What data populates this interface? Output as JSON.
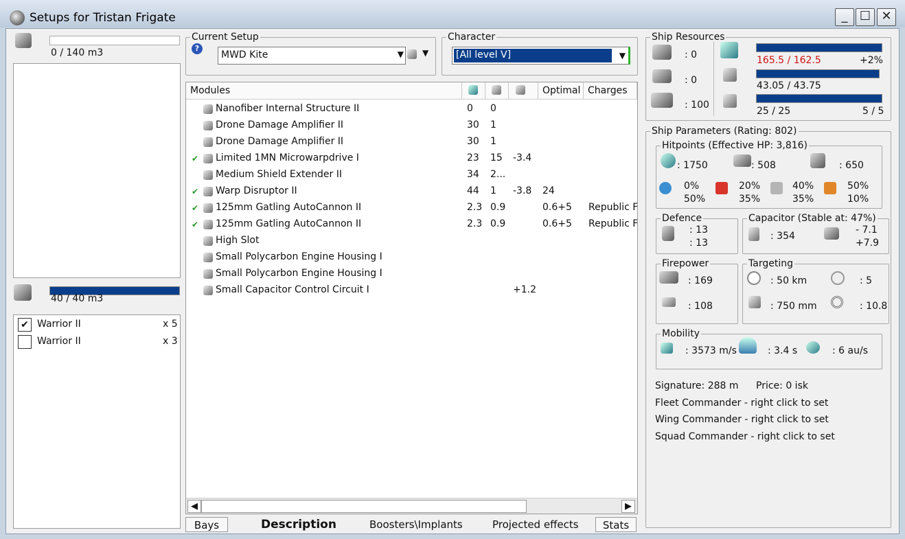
{
  "window": {
    "title": "Setups for Tristan Frigate",
    "minimize": "_",
    "maximize": "☐",
    "close": "✕"
  },
  "cargo": {
    "value": "0 / 140 m3"
  },
  "drone_bay": {
    "value": "40 / 40 m3",
    "items": [
      {
        "name": "Warrior II",
        "qty": "x 5",
        "checked": true
      },
      {
        "name": "Warrior II",
        "qty": "x 3",
        "checked": false
      }
    ]
  },
  "setup": {
    "legend": "Current Setup",
    "help": "?",
    "name": "MWD Kite"
  },
  "character": {
    "legend": "Character",
    "value": "[All level V]"
  },
  "modules": {
    "headers": [
      "Modules",
      "",
      "",
      "",
      "Optimal",
      "Charges"
    ],
    "rows": [
      {
        "check": "",
        "name": "Nanofiber Internal Structure II",
        "c1": "0",
        "c2": "0",
        "c3": "",
        "opt": "",
        "charge": ""
      },
      {
        "check": "",
        "name": "Drone Damage Amplifier II",
        "c1": "30",
        "c2": "1",
        "c3": "",
        "opt": "",
        "charge": ""
      },
      {
        "check": "",
        "name": "Drone Damage Amplifier II",
        "c1": "30",
        "c2": "1",
        "c3": "",
        "opt": "",
        "charge": ""
      },
      {
        "check": "✔",
        "name": "Limited 1MN Microwarpdrive I",
        "c1": "23",
        "c2": "15",
        "c3": "-3.4",
        "opt": "",
        "charge": ""
      },
      {
        "check": "",
        "name": "Medium Shield Extender II",
        "c1": "34",
        "c2": "2...",
        "c3": "",
        "opt": "",
        "charge": ""
      },
      {
        "check": "✔",
        "name": "Warp Disruptor II",
        "c1": "44",
        "c2": "1",
        "c3": "-3.8",
        "opt": "24",
        "charge": ""
      },
      {
        "check": "✔",
        "name": "125mm Gatling AutoCannon II",
        "c1": "2.3",
        "c2": "0.9",
        "c3": "",
        "opt": "0.6+5",
        "charge": "Republic F"
      },
      {
        "check": "✔",
        "name": "125mm Gatling AutoCannon II",
        "c1": "2.3",
        "c2": "0.9",
        "c3": "",
        "opt": "0.6+5",
        "charge": "Republic F"
      },
      {
        "check": "",
        "name": "High Slot",
        "c1": "",
        "c2": "",
        "c3": "",
        "opt": "",
        "charge": ""
      },
      {
        "check": "",
        "name": "Small Polycarbon Engine Housing I",
        "c1": "",
        "c2": "",
        "c3": "",
        "opt": "",
        "charge": ""
      },
      {
        "check": "",
        "name": "Small Polycarbon Engine Housing I",
        "c1": "",
        "c2": "",
        "c3": "",
        "opt": "",
        "charge": ""
      },
      {
        "check": "",
        "name": "Small Capacitor Control Circuit I",
        "c1": "",
        "c2": "",
        "c3": "+1.2",
        "opt": "",
        "charge": ""
      }
    ]
  },
  "tabs": [
    "Bays",
    "Description",
    "Boosters\\Implants",
    "Projected effects",
    "Stats"
  ],
  "scroll": {
    "left": "◀",
    "right": "▶"
  },
  "resources": {
    "legend": "Ship Resources",
    "turrets": ": 0",
    "launchers": ": 0",
    "calibration": ": 100",
    "cpu": "165.5 / 162.5",
    "cpu_pct": "+2%",
    "pg": "43.05 / 43.75",
    "drone_bw": "25 / 25",
    "drones_active": "5 / 5",
    "cpu_fill": 1.0,
    "pg_fill": 0.98,
    "bw_fill": 1.0
  },
  "params": {
    "legend": "Ship Parameters (Rating: 802)",
    "hp_legend": "Hitpoints (Effective HP: 3,816)",
    "shield": ": 1750",
    "armor": ": 508",
    "hull": ": 650",
    "res": [
      [
        "0%",
        "50%"
      ],
      [
        "20%",
        "35%"
      ],
      [
        "40%",
        "35%"
      ],
      [
        "50%",
        "10%"
      ]
    ],
    "defence_legend": "Defence",
    "def1": ": 13",
    "def2": ": 13",
    "cap_legend": "Capacitor (Stable at: 47%)",
    "cap": ": 354",
    "cap1": "- 7.1",
    "cap2": "+7.9",
    "fire_legend": "Firepower",
    "fire1": ": 169",
    "fire2": ": 108",
    "tgt_legend": "Targeting",
    "range": ": 50 km",
    "maxtgt": ": 5",
    "res_scan": ": 750 mm",
    "scanres": ": 10.8",
    "mob_legend": "Mobility",
    "speed": ": 3573 m/s",
    "align": ": 3.4 s",
    "warp": ": 6 au/s",
    "signature": "Signature: 288 m",
    "price": "Price: 0 isk",
    "fleet": "Fleet Commander - right click to set",
    "wing": "Wing Commander - right click to set",
    "squad": "Squad Commander - right click to set"
  }
}
